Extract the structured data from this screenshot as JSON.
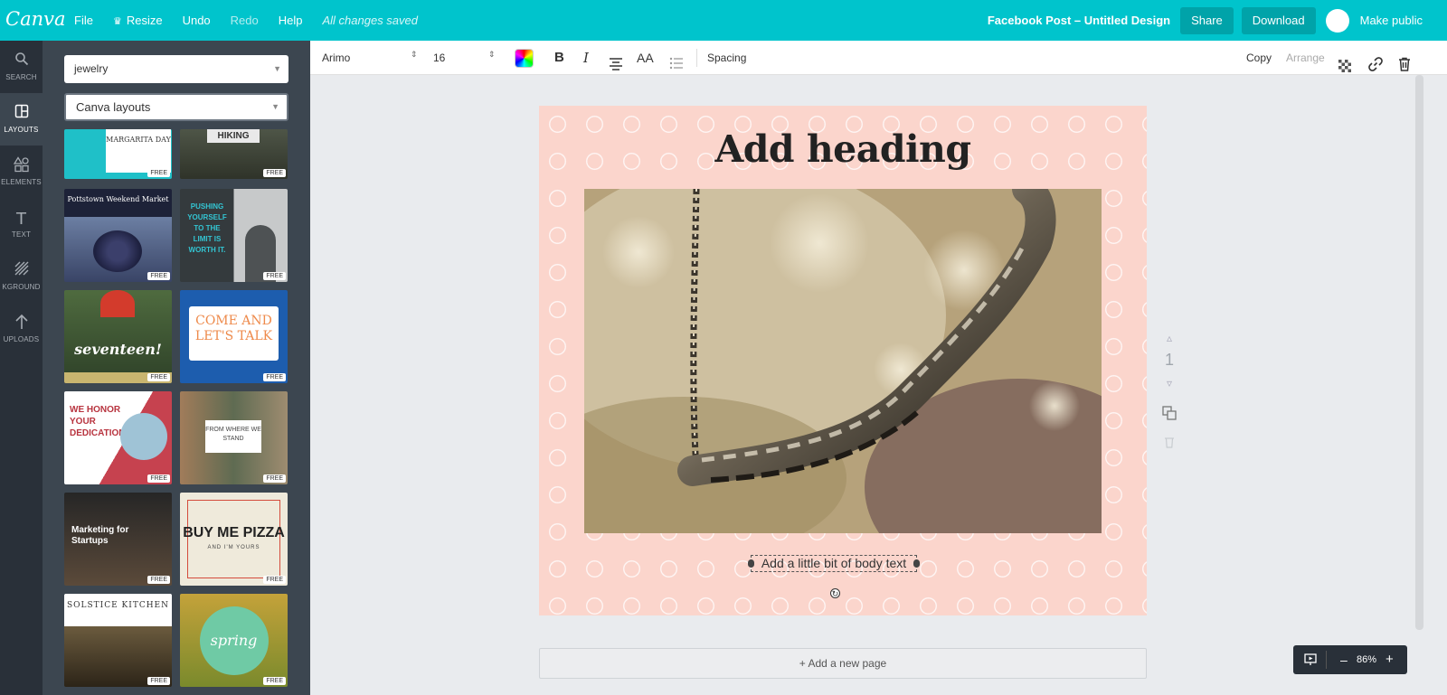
{
  "topbar": {
    "logo": "Canva",
    "file": "File",
    "resize": "Resize",
    "undo": "Undo",
    "redo": "Redo",
    "help": "Help",
    "saved_status": "All changes saved",
    "design_title": "Facebook Post – Untitled Design",
    "share": "Share",
    "download": "Download",
    "make_public": "Make public"
  },
  "rail": {
    "search": "SEARCH",
    "layouts": "LAYOUTS",
    "elements": "ELEMENTS",
    "text": "TEXT",
    "background": "KGROUND",
    "uploads": "UPLOADS"
  },
  "panel": {
    "search_value": "jewelry",
    "layouts_select": "Canva layouts",
    "free_badge": "FREE",
    "thumbs": {
      "t1": "MARGARITA DAY",
      "t2": "HIKING",
      "t3": "Pottstown Weekend Market",
      "t4": "PUSHING YOURSELF TO THE LIMIT IS WORTH IT.",
      "t5": "seventeen!",
      "t6": "COME AND LET'S TALK",
      "t7": "WE HONOR YOUR DEDICATION",
      "t8": "FROM WHERE WE STAND",
      "t9": "Marketing for Startups",
      "t10": "BUY ME PIZZA",
      "t10b": "AND I'M YOURS",
      "t11": "SOLSTICE KITCHEN",
      "t12": "spring"
    }
  },
  "toolbar": {
    "font": "Arimo",
    "size": "16",
    "bold": "B",
    "italic": "I",
    "case": "AA",
    "spacing": "Spacing",
    "copy": "Copy",
    "arrange": "Arrange"
  },
  "canvas": {
    "heading": "Add heading",
    "body": "Add a little bit of body text",
    "page_number": "1",
    "add_page": "+ Add a new page"
  },
  "zoom": {
    "minus": "–",
    "value": "86%",
    "plus": "+"
  },
  "colors": {
    "topbar": "#00c4cc",
    "rail": "#293039",
    "panel": "#3c4650",
    "page_bg": "#fbd5cc"
  }
}
